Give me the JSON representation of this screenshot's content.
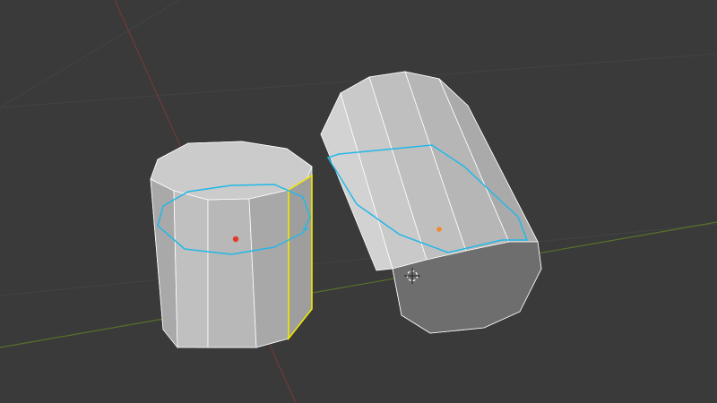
{
  "viewport": {
    "name": "3D Viewport",
    "background": "#3a3a3a",
    "grid_color": "#444444",
    "x_axis_color": "#7a3b3b",
    "y_axis_color": "#5a7a2a"
  },
  "objects": [
    {
      "name": "upright-cylinder",
      "face_color": "#bdbdbd",
      "edge_color": "#ffffff",
      "origin_color": "#e23b2a",
      "selected_edge_color": "#f3e600"
    },
    {
      "name": "tilted-cylinder",
      "face_color": "#c6c6c6",
      "edge_color": "#ffffff",
      "origin_color": "#f08a2a"
    }
  ],
  "loop_cut": {
    "color": "#22b8e8"
  }
}
